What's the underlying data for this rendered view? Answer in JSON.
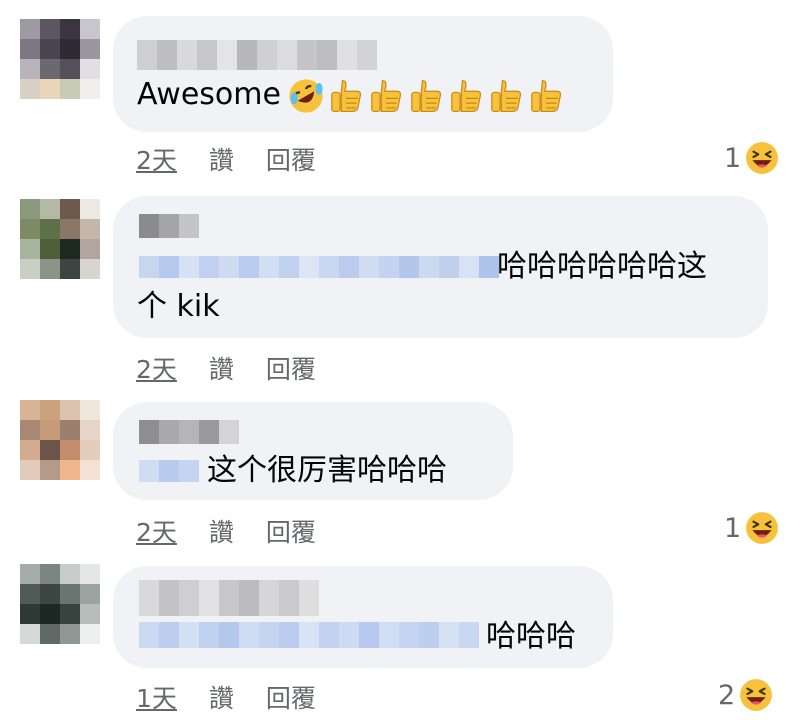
{
  "comments": [
    {
      "text": "Awesome",
      "time": "2天",
      "like_label": "讚",
      "reply_label": "回覆",
      "reaction_count": "1",
      "reaction_icon": "laughing-emoji-icon"
    },
    {
      "text_line1": "哈哈哈哈哈哈这",
      "text_line2": "个 kik",
      "time": "2天",
      "like_label": "讚",
      "reply_label": "回覆"
    },
    {
      "text": "这个很厉害哈哈哈",
      "time": "2天",
      "like_label": "讚",
      "reply_label": "回覆",
      "reaction_count": "1",
      "reaction_icon": "laughing-emoji-icon"
    },
    {
      "text": "哈哈哈",
      "time": "1天",
      "like_label": "讚",
      "reply_label": "回覆",
      "reaction_count": "2",
      "reaction_icon": "laughing-emoji-icon"
    }
  ],
  "emojis_comment1": [
    "rolling-laughing-emoji-icon",
    "thumbs-up-emoji-icon",
    "thumbs-up-emoji-icon",
    "thumbs-up-emoji-icon",
    "thumbs-up-emoji-icon",
    "thumbs-up-emoji-icon",
    "thumbs-up-emoji-icon"
  ],
  "colors": {
    "bubble_bg": "#f0f2f5",
    "meta_text": "#65676b",
    "body_text": "#050505",
    "reaction_yellow": "#f7c23b"
  }
}
